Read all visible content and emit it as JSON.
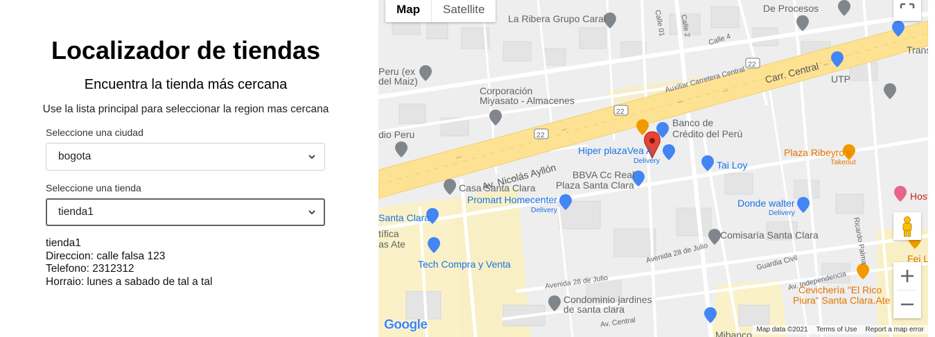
{
  "page": {
    "title": "Localizador de tiendas",
    "subtitle": "Encuentra la tienda más cercana",
    "instructions": "Use la lista principal para seleccionar la region mas cercana"
  },
  "form": {
    "city_label": "Seleccione una ciudad",
    "city_value": "bogota",
    "store_label": "Seleccione una tienda",
    "store_value": "tienda1"
  },
  "store_info": {
    "name": "tienda1",
    "address": "Direccion: calle falsa 123",
    "phone": "Telefono: 2312312",
    "hours": "Horraio: lunes a sabado de tal a tal"
  },
  "map": {
    "type_map": "Map",
    "type_satellite": "Satellite",
    "google_logo": "Google",
    "footer": {
      "data": "Map data ©2021",
      "terms": "Terms of Use",
      "report": "Report a map error"
    },
    "labels": {
      "la_ribera": "La Ribera Grupo Caral",
      "de_procesos": "De Procesos",
      "peru_maiz_1": "Peru (ex",
      "peru_maiz_2": "del Maiz)",
      "corporacion_1": "Corporación",
      "corporacion_2": "Miyasato - Almacenes",
      "radio_peru": "dio Peru",
      "banco_1": "Banco de",
      "banco_2": "Crédito del Perú",
      "hiper_plaza": "Hiper plazaVea A",
      "hiper_delivery": "Delivery",
      "tai_loy": "Tai Loy",
      "plaza_ribeyros": "Plaza Ribeyro's",
      "plaza_takeout": "Takeout",
      "bbva_1": "BBVA Cc Real",
      "bbva_2": "Plaza Santa Clara",
      "casa_santa_clara": "Casa Santa Clara",
      "promart": "Promart Homecenter",
      "promart_delivery": "Delivery",
      "santa_clara": "Santa Clara",
      "tifica_1": "tífica",
      "tifica_2": "as Ate",
      "tech_compra": "Tech Compra y Venta",
      "donde_walter": "Donde walter",
      "donde_delivery": "Delivery",
      "comisaria": "Comisaría Santa Clara",
      "guardia_civil": "Guardia Civil",
      "av_independencia": "Av. Independencia",
      "cevicheria_1": "Cevichería \"El Rico",
      "cevicheria_2": "Piura\" Santa Clara.Ate",
      "condominio_1": "Condominio jardines",
      "condominio_2": "de santa clara",
      "av_central": "Av. Central",
      "mibanco": "Mibanco",
      "utp": "UTP",
      "trans": "Trans",
      "host": "Host",
      "fei_len": "Fei Len",
      "carr_central": "Carr. Central",
      "av_nicolas": "Av. Nicolás Ayllón",
      "auxiliar": "Auxiliar Carretera Central",
      "av_28_julio_1": "Avenida 28 de Julio",
      "av_28_julio_2": "Avenida 28 de Julio",
      "ricardo_palma": "Ricardo Palma",
      "calle_2": "Calle 2",
      "calle_4": "Calle 4",
      "calle_01": "Calle 01",
      "route_22": "22"
    }
  }
}
